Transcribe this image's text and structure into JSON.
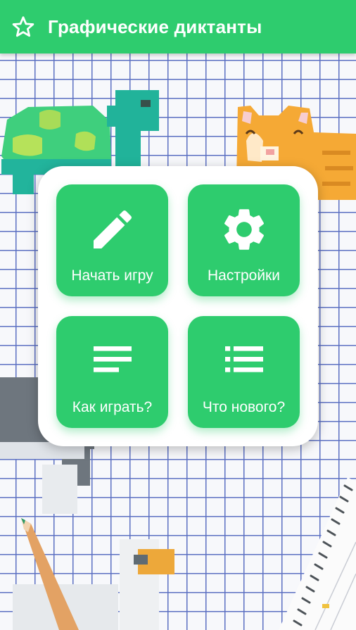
{
  "app": {
    "title": "Графические диктанты",
    "favorite_icon": "star-outline-icon"
  },
  "menu": {
    "items": [
      {
        "label": "Начать игру",
        "icon": "pencil-icon"
      },
      {
        "label": "Настройки",
        "icon": "gear-icon"
      },
      {
        "label": "Как играть?",
        "icon": "text-lines-icon"
      },
      {
        "label": "Что нового?",
        "icon": "list-icon"
      }
    ]
  },
  "colors": {
    "accent": "#2ecc6e",
    "card": "#ffffff",
    "grid": "#5b6fc2",
    "paper": "#f7f8fb"
  }
}
